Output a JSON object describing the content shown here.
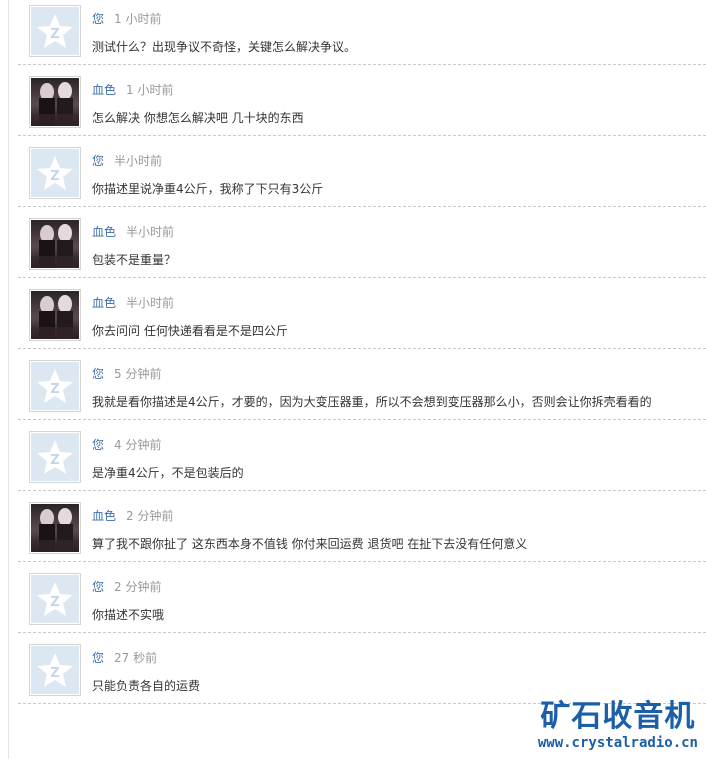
{
  "comments": [
    {
      "author": "您",
      "time": "1 小时前",
      "text": "测试什么？出现争议不奇怪，关键怎么解决争议。",
      "avatar": "default-avatar-icon"
    },
    {
      "author": "血色",
      "time": "1 小时前",
      "text": "怎么解决  你想怎么解决吧  几十块的东西",
      "avatar": "photo"
    },
    {
      "author": "您",
      "time": "半小时前",
      "text": "你描述里说净重4公斤，我称了下只有3公斤",
      "avatar": "default-avatar-icon"
    },
    {
      "author": "血色",
      "time": "半小时前",
      "text": "包装不是重量？",
      "avatar": "photo"
    },
    {
      "author": "血色",
      "time": "半小时前",
      "text": "你去问问 任何快递看看是不是四公斤",
      "avatar": "photo"
    },
    {
      "author": "您",
      "time": "5 分钟前",
      "text": "我就是看你描述是4公斤，才要的，因为大变压器重，所以不会想到变压器那么小，否则会让你拆壳看看的",
      "avatar": "default-avatar-icon"
    },
    {
      "author": "您",
      "time": "4 分钟前",
      "text": "是净重4公斤，不是包装后的",
      "avatar": "default-avatar-icon"
    },
    {
      "author": "血色",
      "time": "2 分钟前",
      "text": "算了我不跟你扯了  这东西本身不值钱  你付来回运费 退货吧  在扯下去没有任何意义",
      "avatar": "photo"
    },
    {
      "author": "您",
      "time": "2 分钟前",
      "text": "你描述不实哦",
      "avatar": "default-avatar-icon"
    },
    {
      "author": "您",
      "time": "27 秒前",
      "text": "只能负责各自的运费",
      "avatar": "default-avatar-icon"
    }
  ],
  "watermark": {
    "title": "矿石收音机",
    "url": "www.crystalradio.cn"
  }
}
